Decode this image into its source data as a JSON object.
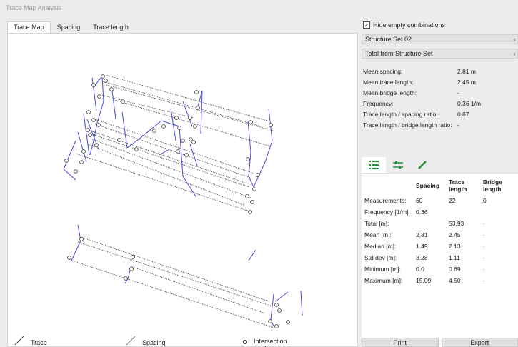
{
  "window": {
    "title": "Trace Map Analysis"
  },
  "tabs": [
    {
      "label": "Trace Map",
      "active": true
    },
    {
      "label": "Spacing",
      "active": false
    },
    {
      "label": "Trace length",
      "active": false
    }
  ],
  "legend": {
    "trace_label": "Trace",
    "spacing_label": "Spacing",
    "intersection_label": "Intersection mark"
  },
  "options": {
    "hide_empty_label": "Hide empty combinations",
    "hide_empty_checked": true
  },
  "structure_select": {
    "value": "Structure Set 02"
  },
  "total_select": {
    "value": "Total from Structure Set"
  },
  "summary": [
    {
      "label": "Mean spacing:",
      "value": "2.81 m"
    },
    {
      "label": "Mean trace length:",
      "value": "2.45 m"
    },
    {
      "label": "Mean bridge length:",
      "value": "-"
    },
    {
      "label": "Frequency:",
      "value": "0.36 1/m"
    },
    {
      "label": "Trace length / spacing ratio:",
      "value": "0.87"
    },
    {
      "label": "Trace length / bridge length ratio:",
      "value": "-"
    }
  ],
  "toolbar_icons": [
    "table-icon",
    "sliders-icon",
    "pencil-icon"
  ],
  "table": {
    "headers": [
      "",
      "Spacing",
      "Trace length",
      "Bridge length"
    ],
    "rows": [
      [
        "Measurements:",
        "60",
        "22",
        "0"
      ],
      [
        "Frequency [1/m]:",
        "0.36",
        "",
        ""
      ],
      [
        "Total [m]:",
        "",
        "53.93",
        "-"
      ],
      [
        "Mean [m]:",
        "2.81",
        "2.45",
        "-"
      ],
      [
        "Median [m]:",
        "1.49",
        "2.13",
        "-"
      ],
      [
        "Std dev [m]:",
        "3.28",
        "1.11",
        "-"
      ],
      [
        "Minimum [m]:",
        "0.0",
        "0.69",
        "-"
      ],
      [
        "Maximum [m]:",
        "15.09",
        "4.50",
        "-"
      ]
    ]
  },
  "buttons": {
    "print": "Print",
    "export": "Export"
  },
  "colors": {
    "trace": "#4a4ad8",
    "spacing": "#333333",
    "accent": "#1f8f3a"
  }
}
